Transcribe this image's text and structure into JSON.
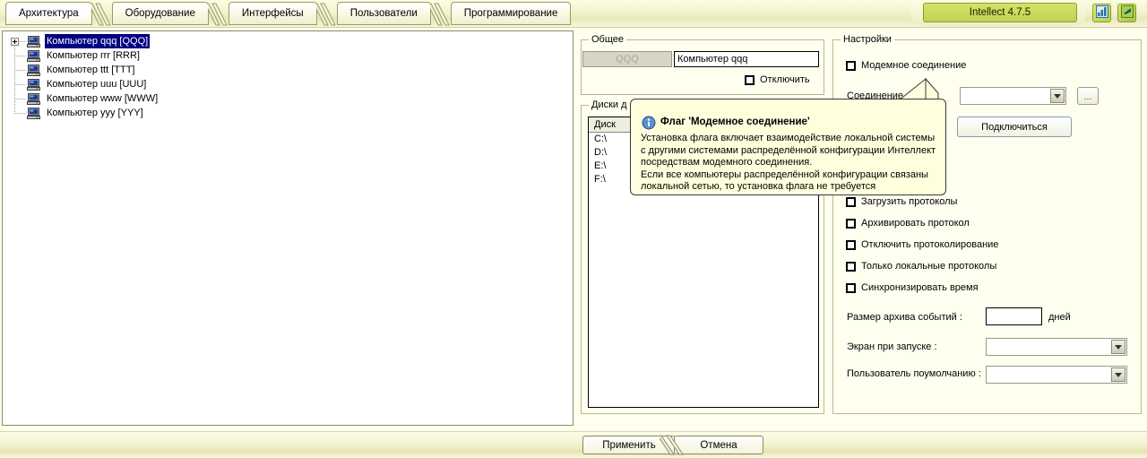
{
  "tabs": [
    {
      "label": "Архитектура",
      "selected": true
    },
    {
      "label": "Оборудование",
      "selected": false
    },
    {
      "label": "Интерфейсы",
      "selected": false
    },
    {
      "label": "Пользователи",
      "selected": false
    },
    {
      "label": "Программирование",
      "selected": false
    }
  ],
  "version_badge": "Intellect 4.7.5",
  "toolbar_icons": [
    {
      "name": "chart-icon"
    },
    {
      "name": "green-arrow-icon"
    }
  ],
  "tree": {
    "items": [
      {
        "label": "Компьютер qqq [QQQ]",
        "selected": true,
        "expandable": true
      },
      {
        "label": "Компьютер rrr [RRR]",
        "selected": false,
        "expandable": false
      },
      {
        "label": "Компьютер ttt [TTT]",
        "selected": false,
        "expandable": false
      },
      {
        "label": "Компьютер uuu [UUU]",
        "selected": false,
        "expandable": false
      },
      {
        "label": "Компьютер www [WWW]",
        "selected": false,
        "expandable": false
      },
      {
        "label": "Компьютер yyy [YYY]",
        "selected": false,
        "expandable": false
      }
    ]
  },
  "general": {
    "title": "Общее",
    "id_value": "QQQ",
    "name_value": "Компьютер qqq",
    "disable_label": "Отключить"
  },
  "disks": {
    "title": "Диски д",
    "column_header": "Диск",
    "rows": [
      "C:\\",
      "D:\\",
      "E:\\",
      "F:\\"
    ]
  },
  "settings": {
    "title": "Настройки",
    "modem_label": "Модемное соединение",
    "connection_label": "Соединение :",
    "connection_value": "",
    "browse_label": "...",
    "connect_button": "Подключиться",
    "checkboxes": [
      "Загрузить протоколы",
      "Архивировать протокол",
      "Отключить протоколирование",
      "Только локальные протоколы",
      "Синхронизировать время"
    ],
    "archive_size_label": "Размер архива событий :",
    "archive_size_value": "",
    "archive_size_units": "дней",
    "startup_screen_label": "Экран при запуске :",
    "startup_screen_value": "",
    "default_user_label": "Пользователь поумолчанию :",
    "default_user_value": ""
  },
  "tooltip": {
    "title": "Флаг 'Модемное соединение'",
    "lines": [
      "Установка флага включает взаимодействие локальной системы",
      "с другими системами распределённой конфигурации Интеллект",
      "посредствам модемного соединения.",
      "Если все компьютеры распределённой конфигурации связаны",
      "локальной сетью, то установка флага не требуется"
    ]
  },
  "footer": {
    "apply": "Применить",
    "cancel": "Отмена"
  }
}
